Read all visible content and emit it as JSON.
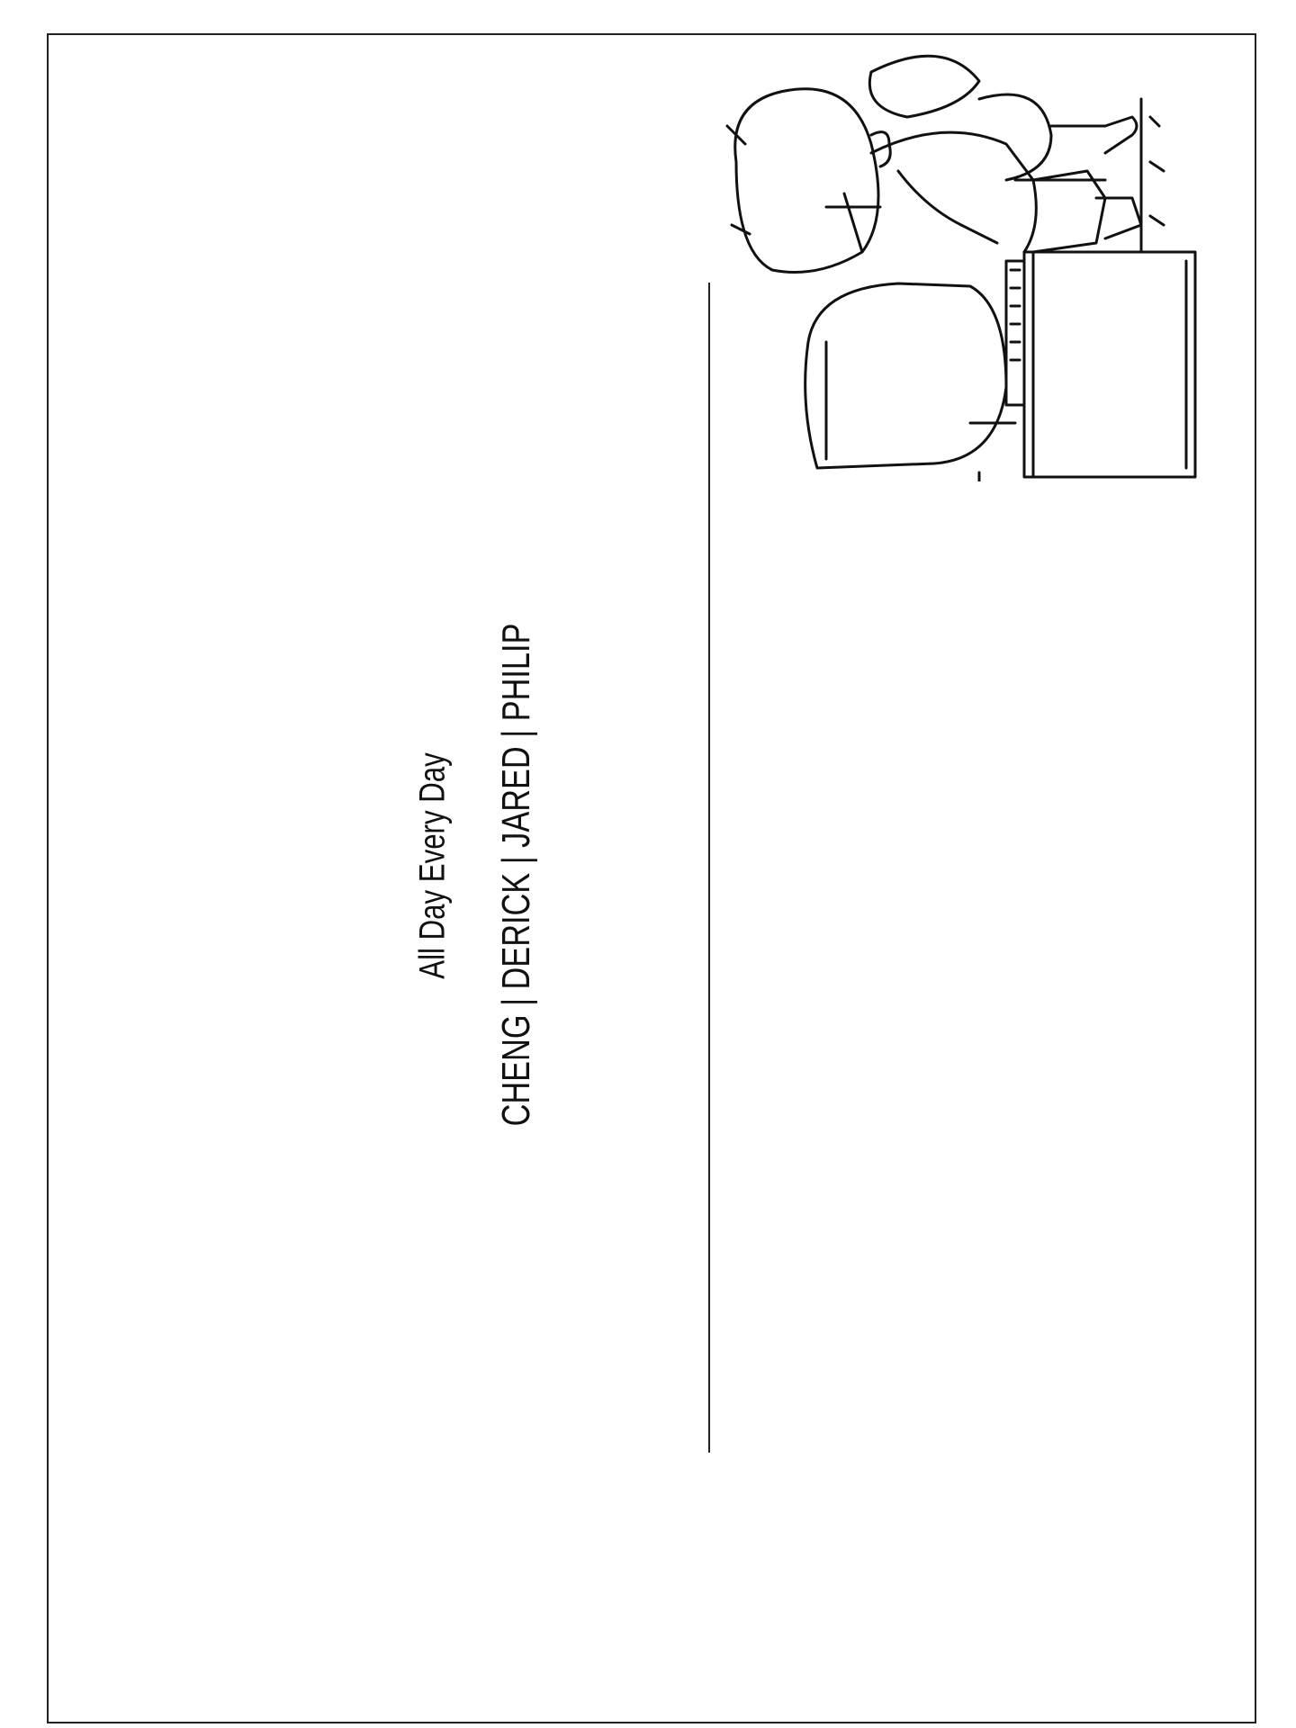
{
  "card": {
    "title": "All Day Every Day",
    "names": "CHENG | DERICK | JARED | PHILIP",
    "illustration": "boy-at-computer-line-drawing",
    "line_color": "#222222"
  }
}
